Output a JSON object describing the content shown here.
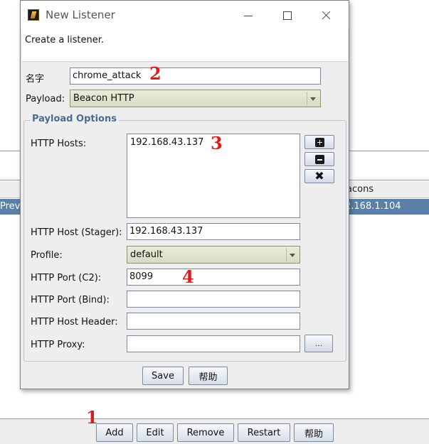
{
  "background": {
    "table_headers": {
      "col_right": "acons"
    },
    "selected_row": {
      "cell_left": "Preve",
      "cell_right": "2.168.1.104"
    },
    "bottom_buttons": {
      "add": "Add",
      "edit": "Edit",
      "remove": "Remove",
      "restart": "Restart",
      "help": "帮助"
    }
  },
  "dialog": {
    "title": "New Listener",
    "description": "Create a listener.",
    "name_label": "名字",
    "name_value": "chrome_attack",
    "payload_label": "Payload:",
    "payload_value": "Beacon HTTP",
    "options_group_title": "Payload Options",
    "http_hosts_label": "HTTP Hosts:",
    "http_hosts_value": "192.168.43.137",
    "http_host_stager_label": "HTTP Host (Stager):",
    "http_host_stager_value": "192.168.43.137",
    "profile_label": "Profile:",
    "profile_value": "default",
    "http_port_c2_label": "HTTP Port (C2):",
    "http_port_c2_value": "8099",
    "http_port_bind_label": "HTTP Port (Bind):",
    "http_port_bind_value": "",
    "http_host_header_label": "HTTP Host Header:",
    "http_host_header_value": "",
    "http_proxy_label": "HTTP Proxy:",
    "http_proxy_value": "",
    "proxy_button_label": "...",
    "save_label": "Save",
    "help_label": "帮助"
  },
  "annotations": {
    "marker_1": "1",
    "marker_2": "2",
    "marker_3": "3",
    "marker_4": "4",
    "color": "#d81e1e"
  },
  "icons": {
    "add_host": "plus-icon",
    "remove_host": "minus-icon",
    "clear_hosts": "x-icon"
  }
}
